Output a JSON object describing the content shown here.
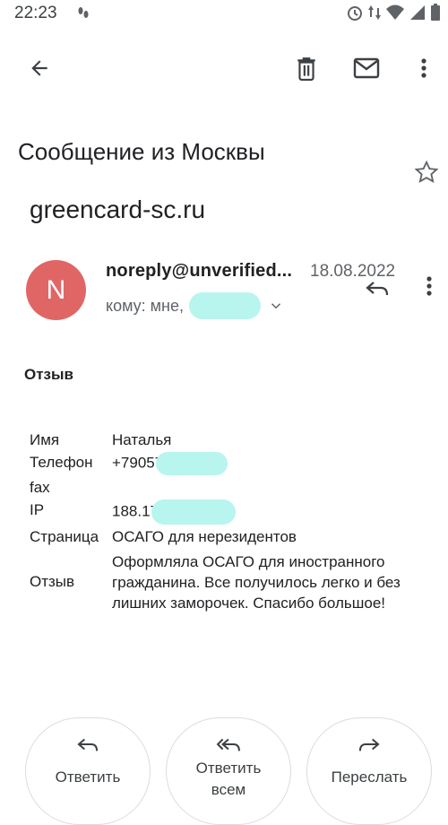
{
  "status": {
    "time": "22:23"
  },
  "toolbar": {
    "back_icon": "arrow-left-icon",
    "delete_icon": "trash-icon",
    "mark_unread_icon": "envelope-icon",
    "more_icon": "more-vert-icon"
  },
  "email": {
    "subject": "Сообщение из Москвы",
    "label": "greencard-sc.ru",
    "avatar_letter": "N",
    "avatar_color": "#e06666",
    "sender": "noreply@unverified...",
    "date": "18.08.2022",
    "recipient_prefix": "кому: мне,",
    "body_title": "Отзыв",
    "fields": [
      {
        "key": "Имя",
        "value": "Наталья"
      },
      {
        "key": "Телефон",
        "value": "+79057"
      },
      {
        "key": "fax",
        "value": ""
      },
      {
        "key": "IP",
        "value": "188.17"
      },
      {
        "key": "Страница",
        "value": "ОСАГО для нерезидентов"
      },
      {
        "key": "Отзыв",
        "value": "Оформляла ОСАГО для иностранного гражданина. Все получилось легко и без лишних заморочек. Спасибо большое!"
      }
    ]
  },
  "actions": {
    "reply": "Ответить",
    "reply_all": "Ответить всем",
    "forward": "Переслать"
  }
}
